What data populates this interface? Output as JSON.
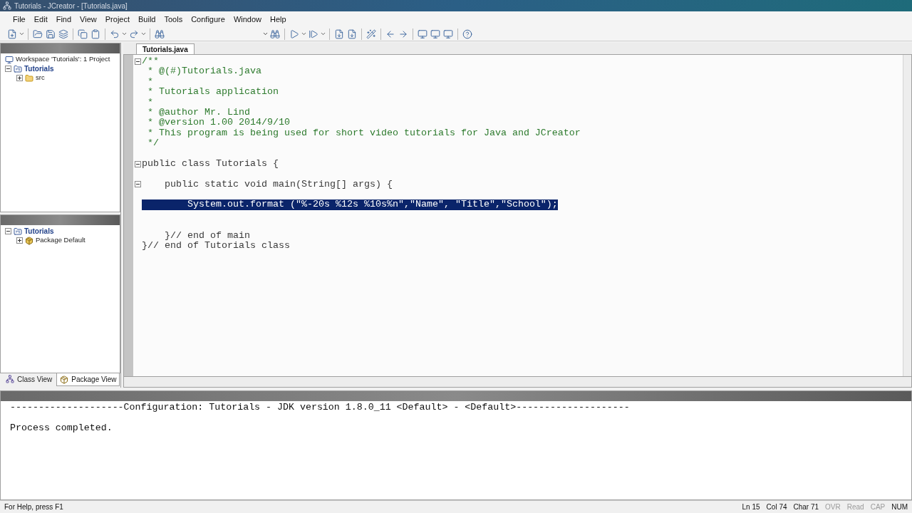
{
  "window": {
    "title": "Tutorials - JCreator - [Tutorials.java]"
  },
  "menu": [
    "File",
    "Edit",
    "Find",
    "View",
    "Project",
    "Build",
    "Tools",
    "Configure",
    "Window",
    "Help"
  ],
  "workspace_tree": [
    {
      "label": "Workspace 'Tutorials': 1 Project",
      "kind": "workspace",
      "children": [
        {
          "label": "Tutorials",
          "kind": "project",
          "expanded": true,
          "children": [
            {
              "label": "src",
              "kind": "folder",
              "expanded": false
            }
          ]
        }
      ]
    }
  ],
  "package_tree": [
    {
      "label": "Tutorials",
      "kind": "project",
      "expanded": true,
      "children": [
        {
          "label": "Package Default",
          "kind": "package",
          "expanded": false
        }
      ]
    }
  ],
  "view_tabs": [
    {
      "label": "Class View",
      "kind": "class",
      "selected": false
    },
    {
      "label": "Package View",
      "kind": "package",
      "selected": true
    }
  ],
  "editor": {
    "tab": "Tutorials.java",
    "lines": [
      {
        "kind": "comment",
        "text": "/**",
        "fold": true,
        "selected": false
      },
      {
        "kind": "comment",
        "text": " * @(#)Tutorials.java",
        "fold": false,
        "selected": false
      },
      {
        "kind": "comment",
        "text": " *",
        "fold": false,
        "selected": false
      },
      {
        "kind": "comment",
        "text": " * Tutorials application",
        "fold": false,
        "selected": false
      },
      {
        "kind": "comment",
        "text": " *",
        "fold": false,
        "selected": false
      },
      {
        "kind": "comment",
        "text": " * @author Mr. Lind",
        "fold": false,
        "selected": false
      },
      {
        "kind": "comment",
        "text": " * @version 1.00 2014/9/10",
        "fold": false,
        "selected": false
      },
      {
        "kind": "comment",
        "text": " * This program is being used for short video tutorials for Java and JCreator",
        "fold": false,
        "selected": false
      },
      {
        "kind": "comment",
        "text": " */",
        "fold": false,
        "selected": false
      },
      {
        "kind": "blank",
        "fold": false,
        "selected": false
      },
      {
        "kind": "code",
        "text": "public class Tutorials {",
        "fold": true,
        "selected": false
      },
      {
        "kind": "blank",
        "fold": false,
        "selected": false
      },
      {
        "kind": "code",
        "text": "    public static void main(String[] args) {",
        "fold": true,
        "selected": false
      },
      {
        "kind": "blank",
        "fold": false,
        "selected": false
      },
      {
        "kind": "code",
        "text": "        System.out.format (\"%-20s %12s %10s%n\",\"Name\", \"Title\",\"School\");",
        "fold": false,
        "selected": true
      },
      {
        "kind": "blank",
        "fold": false,
        "selected": false
      },
      {
        "kind": "blank",
        "fold": false,
        "selected": false
      },
      {
        "kind": "code",
        "text": "    }// end of main",
        "fold": false,
        "selected": false
      },
      {
        "kind": "code",
        "text": "}// end of Tutorials class",
        "fold": false,
        "selected": false
      }
    ]
  },
  "output": [
    "--------------------Configuration: Tutorials - JDK version 1.8.0_11 <Default> - <Default>--------------------",
    "Process completed."
  ],
  "status_bar": {
    "help": "For Help, press F1",
    "indicators": [
      {
        "text": "Ln 15",
        "active": true
      },
      {
        "text": "Col 74",
        "active": true
      },
      {
        "text": "Char 71",
        "active": true
      },
      {
        "text": "OVR",
        "active": false
      },
      {
        "text": "Read",
        "active": false
      },
      {
        "text": "CAP",
        "active": false
      },
      {
        "text": "NUM",
        "active": true
      }
    ]
  }
}
